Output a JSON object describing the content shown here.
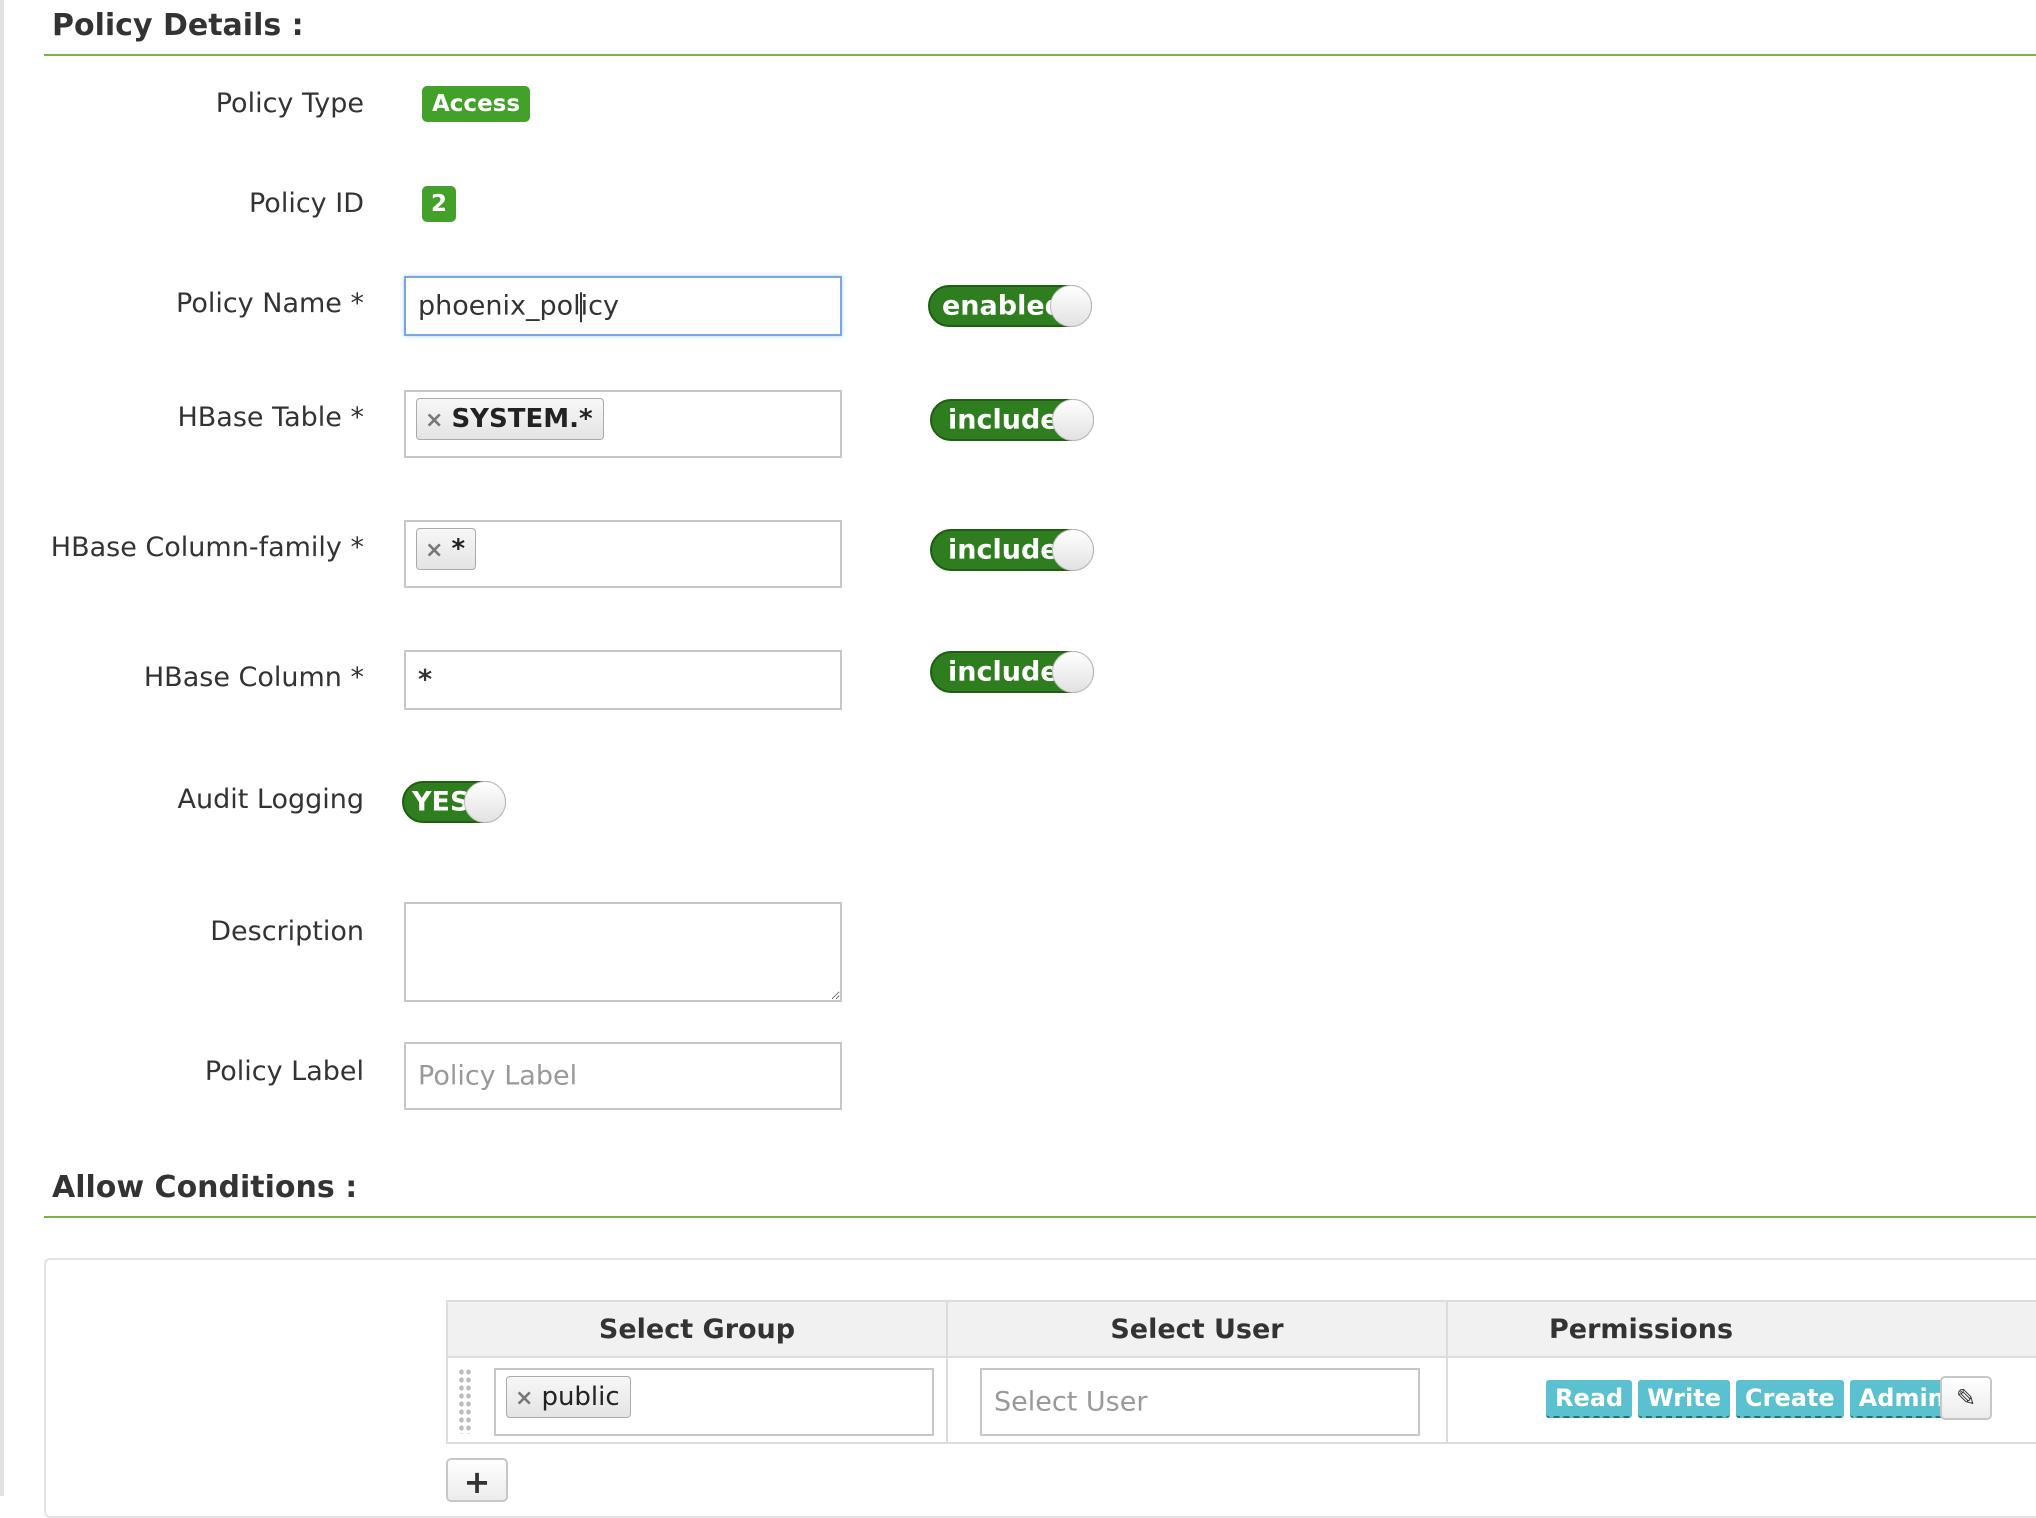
{
  "policy_details": {
    "title": "Policy Details :",
    "policy_type": {
      "label": "Policy Type",
      "value": "Access"
    },
    "policy_id": {
      "label": "Policy ID",
      "value": "2"
    },
    "policy_name": {
      "label": "Policy Name *",
      "value_before_cursor": "phoenix_pol",
      "value_after_cursor": "icy",
      "toggle": "enabled"
    },
    "hbase_table": {
      "label": "HBase Table *",
      "tag": "SYSTEM.*",
      "remove": "×",
      "toggle": "include"
    },
    "hbase_column_family": {
      "label": "HBase Column-family *",
      "tag": "*",
      "remove": "×",
      "toggle": "include"
    },
    "hbase_column": {
      "label": "HBase Column *",
      "value": "*",
      "toggle": "include"
    },
    "audit_logging": {
      "label": "Audit Logging",
      "toggle": "YES"
    },
    "description": {
      "label": "Description",
      "value": ""
    },
    "policy_label": {
      "label": "Policy Label",
      "placeholder": "Policy Label"
    }
  },
  "allow_conditions": {
    "title": "Allow Conditions :",
    "columns": [
      "Select Group",
      "Select User",
      "Permissions"
    ],
    "row": {
      "group_tag": "public",
      "remove": "×",
      "user_placeholder": "Select User",
      "permissions": [
        "Read",
        "Write",
        "Create",
        "Admin"
      ],
      "edit_icon": "✎"
    },
    "add_label": "+"
  },
  "colors": {
    "accent_green": "#43a029",
    "toggle_green": "#2e7d1e",
    "permission_teal": "#5bc0cf",
    "section_rule": "#7cb342"
  }
}
